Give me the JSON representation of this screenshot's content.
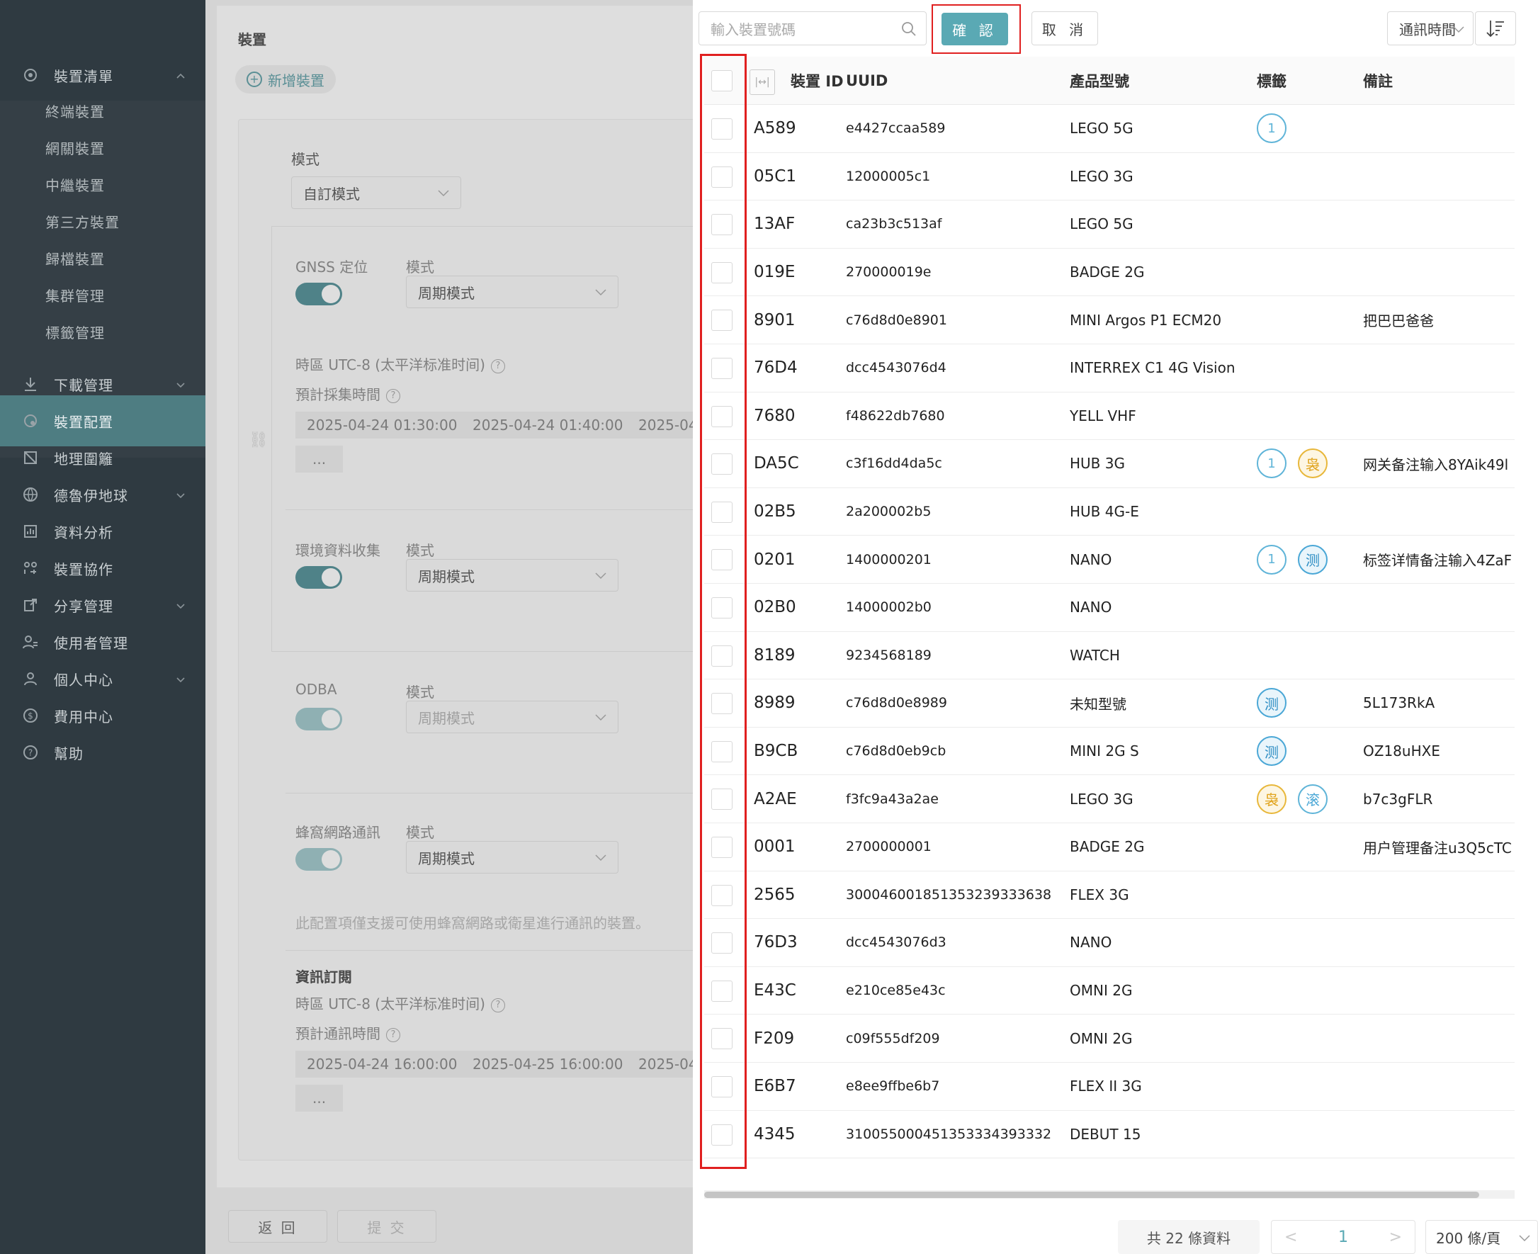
{
  "sidebar": {
    "items": [
      {
        "label": "裝置清單",
        "icon": "devices-icon",
        "expanded": true
      },
      {
        "label": "終端裝置"
      },
      {
        "label": "網關裝置"
      },
      {
        "label": "中繼裝置"
      },
      {
        "label": "第三方裝置"
      },
      {
        "label": "歸檔裝置"
      },
      {
        "label": "集群管理"
      },
      {
        "label": "標籤管理"
      },
      {
        "label": "下載管理",
        "icon": "download-icon"
      },
      {
        "label": "裝置配置",
        "icon": "device-config-icon",
        "active": true
      },
      {
        "label": "地理圍籬",
        "icon": "geofence-icon"
      },
      {
        "label": "德魯伊地球",
        "icon": "globe-icon"
      },
      {
        "label": "資料分析",
        "icon": "analytics-icon"
      },
      {
        "label": "裝置協作",
        "icon": "collaboration-icon"
      },
      {
        "label": "分享管理",
        "icon": "share-icon"
      },
      {
        "label": "使用者管理",
        "icon": "users-icon"
      },
      {
        "label": "個人中心",
        "icon": "person-icon"
      },
      {
        "label": "費用中心",
        "icon": "billing-icon"
      },
      {
        "label": "幫助",
        "icon": "help-icon"
      }
    ]
  },
  "main": {
    "device_label": "裝置",
    "add_device": "新增裝置",
    "mode_label": "模式",
    "mode_value": "自訂模式",
    "gnss": {
      "label": "GNSS 定位",
      "mode_label": "模式",
      "mode_value": "周期模式"
    },
    "timezone": "時區 UTC-8 (太平洋标准时间)",
    "collect_time_label": "預計採集時間",
    "collect_times": [
      "2025-04-24 01:30:00",
      "2025-04-24 01:40:00",
      "2025-04"
    ],
    "more": "...",
    "env": {
      "label": "環境資料收集",
      "mode_label": "模式",
      "mode_value": "周期模式"
    },
    "odba": {
      "label": "ODBA",
      "mode_label": "模式",
      "mode_value": "周期模式"
    },
    "cellular": {
      "label": "蜂窩網路通訊",
      "mode_label": "模式",
      "mode_value": "周期模式"
    },
    "cellular_note": "此配置項僅支援可使用蜂窩網路或衛星進行通訊的裝置。",
    "subscription_title": "資訊訂閱",
    "timezone2": "時區 UTC-8 (太平洋标准时间)",
    "comm_time_label": "預計通訊時間",
    "comm_times": [
      "2025-04-24 16:00:00",
      "2025-04-25 16:00:00",
      "2025-04"
    ],
    "back": "返 回",
    "submit": "提 交"
  },
  "panel": {
    "search_placeholder": "輸入裝置號碼",
    "confirm": "確 認",
    "cancel": "取 消",
    "sort_field": "通訊時間",
    "columns": {
      "id": "裝置 ID",
      "uuid": "UUID",
      "model": "產品型號",
      "tags": "標籤",
      "note": "備註"
    },
    "rows": [
      {
        "id": "A589",
        "uuid": "e4427ccaa589",
        "model": "LEGO 5G",
        "tags": [
          "1"
        ],
        "note": ""
      },
      {
        "id": "05C1",
        "uuid": "12000005c1",
        "model": "LEGO 3G",
        "tags": [],
        "note": ""
      },
      {
        "id": "13AF",
        "uuid": "ca23b3c513af",
        "model": "LEGO 5G",
        "tags": [],
        "note": ""
      },
      {
        "id": "019E",
        "uuid": "270000019e",
        "model": "BADGE 2G",
        "tags": [],
        "note": ""
      },
      {
        "id": "8901",
        "uuid": "c76d8d0e8901",
        "model": "MINI Argos P1 ECM20",
        "tags": [],
        "note": "把巴巴爸爸"
      },
      {
        "id": "76D4",
        "uuid": "dcc4543076d4",
        "model": "INTERREX C1 4G Vision",
        "tags": [],
        "note": ""
      },
      {
        "id": "7680",
        "uuid": "f48622db7680",
        "model": "YELL VHF",
        "tags": [],
        "note": ""
      },
      {
        "id": "DA5C",
        "uuid": "c3f16dd4da5c",
        "model": "HUB 3G",
        "tags": [
          "1",
          "袅"
        ],
        "note": "网关备注输入8YAik49l"
      },
      {
        "id": "02B5",
        "uuid": "2a200002b5",
        "model": "HUB 4G-E",
        "tags": [],
        "note": ""
      },
      {
        "id": "0201",
        "uuid": "1400000201",
        "model": "NANO",
        "tags": [
          "1",
          "测"
        ],
        "note": "标签详情备注输入4ZaF"
      },
      {
        "id": "02B0",
        "uuid": "14000002b0",
        "model": "NANO",
        "tags": [],
        "note": ""
      },
      {
        "id": "8189",
        "uuid": "9234568189",
        "model": "WATCH",
        "tags": [],
        "note": ""
      },
      {
        "id": "8989",
        "uuid": "c76d8d0e8989",
        "model": "未知型號",
        "tags": [
          "测"
        ],
        "note": "5L173RkA"
      },
      {
        "id": "B9CB",
        "uuid": "c76d8d0eb9cb",
        "model": "MINI 2G S",
        "tags": [
          "测"
        ],
        "note": "OZ18uHXE"
      },
      {
        "id": "A2AE",
        "uuid": "f3fc9a43a2ae",
        "model": "LEGO 3G",
        "tags": [
          "袅",
          "滚"
        ],
        "note": "b7c3gFLR"
      },
      {
        "id": "0001",
        "uuid": "2700000001",
        "model": "BADGE 2G",
        "tags": [],
        "note": "用户管理备注u3Q5cTC"
      },
      {
        "id": "2565",
        "uuid": "30004600185135323933363​8",
        "model": "FLEX 3G",
        "tags": [],
        "note": ""
      },
      {
        "id": "76D3",
        "uuid": "dcc4543076d3",
        "model": "NANO",
        "tags": [],
        "note": ""
      },
      {
        "id": "E43C",
        "uuid": "e210ce85e43c",
        "model": "OMNI 2G",
        "tags": [],
        "note": ""
      },
      {
        "id": "F209",
        "uuid": "c09f555df209",
        "model": "OMNI 2G",
        "tags": [],
        "note": ""
      },
      {
        "id": "E6B7",
        "uuid": "e8ee9ffbe6b7",
        "model": "FLEX II 3G",
        "tags": [],
        "note": ""
      },
      {
        "id": "4345",
        "uuid": "310055000451353334393332",
        "model": "DEBUT 15",
        "tags": [],
        "note": ""
      }
    ],
    "total": "共 22 條資料",
    "prev": "<",
    "page": "1",
    "next": ">",
    "per_page": "200 條/頁"
  },
  "colors": {
    "accent": "#5aa9b4",
    "highlight": "#e02020",
    "sidebar": "#2f3a41",
    "active_sidebar": "#4e7d82"
  }
}
